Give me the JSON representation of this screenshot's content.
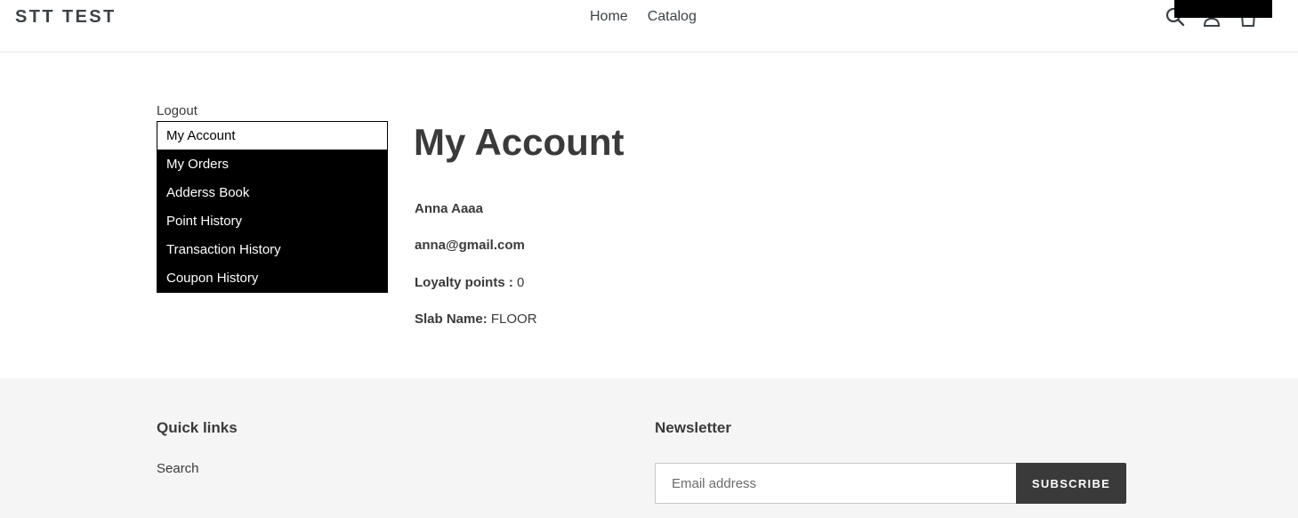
{
  "header": {
    "logo": "STT TEST",
    "nav": [
      {
        "label": "Home"
      },
      {
        "label": "Catalog"
      }
    ],
    "icons": [
      "search-icon",
      "account-icon",
      "cart-icon"
    ]
  },
  "sidebar": {
    "logout": "Logout",
    "items": [
      {
        "label": "My Account",
        "active": true
      },
      {
        "label": "My Orders"
      },
      {
        "label": "Adderss Book"
      },
      {
        "label": "Point History"
      },
      {
        "label": "Transaction History"
      },
      {
        "label": "Coupon History"
      }
    ]
  },
  "main": {
    "title": "My Account",
    "name": "Anna Aaaa",
    "email": "anna@gmail.com",
    "loyalty_label": "Loyalty points :",
    "loyalty_value": "0",
    "slab_label": "Slab Name:",
    "slab_value": "FLOOR"
  },
  "footer": {
    "quick_links_heading": "Quick links",
    "quick_links": [
      {
        "label": "Search"
      }
    ],
    "newsletter_heading": "Newsletter",
    "email_placeholder": "Email address",
    "subscribe_label": "SUBSCRIBE"
  },
  "colors": {
    "text": "#3a3a3a",
    "menu_bg": "#000000",
    "footer_bg": "#f5f5f5",
    "button_bg": "#3a3a3a"
  }
}
